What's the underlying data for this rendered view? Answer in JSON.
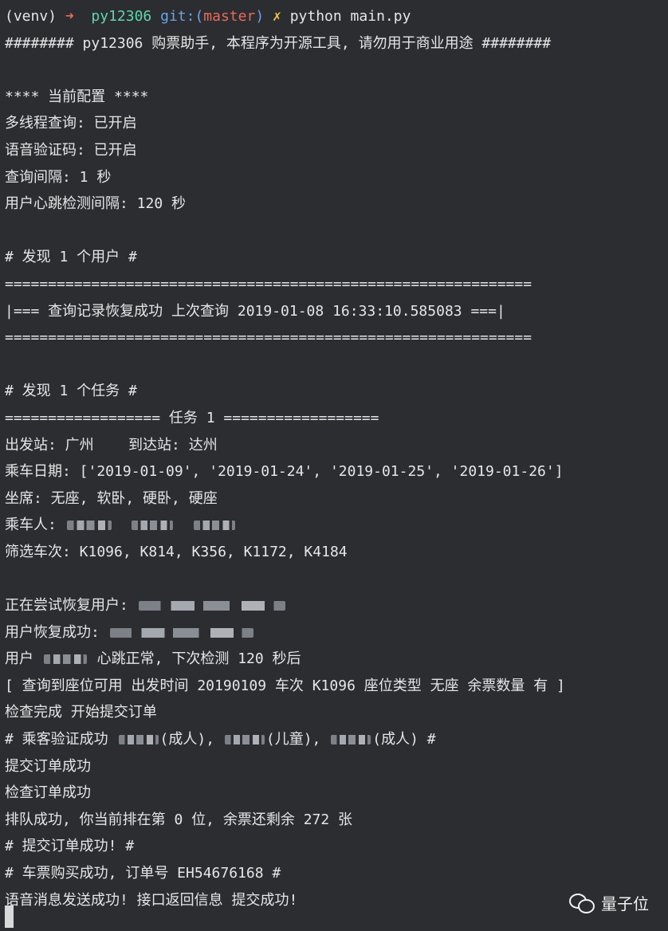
{
  "prompt": {
    "venv": "(venv)",
    "arrow": "➜",
    "dir": "py12306",
    "git_prefix": "git:(",
    "branch": "master",
    "git_suffix": ")",
    "dirty": "✗",
    "command": "python main.py"
  },
  "terminal": {
    "header": "######## py12306 购票助手, 本程序为开源工具, 请勿用于商业用途 ########",
    "config_title": "**** 当前配置 ****",
    "config_multithread": "多线程查询: 已开启",
    "config_voice": "语音验证码: 已开启",
    "config_interval": "查询间隔: 1 秒",
    "config_heartbeat": "用户心跳检测间隔: 120 秒",
    "found_users": "# 发现 1 个用户 #",
    "sep_long_1": "=============================================================",
    "restore_record": "|=== 查询记录恢复成功 上次查询 2019-01-08 16:33:10.585083 ===|",
    "sep_long_2": "=============================================================",
    "found_tasks": "# 发现 1 个任务 #",
    "task_header": "================== 任务 1 ==================",
    "stations": "出发站: 广州    到达站: 达州",
    "dates": "乘车日期: ['2019-01-09', '2019-01-24', '2019-01-25', '2019-01-26']",
    "seats": "坐席: 无座, 软卧, 硬卧, 硬座",
    "passengers_label": "乘车人: ",
    "filter_trains": "筛选车次: K1096, K814, K356, K1172, K4184",
    "restoring_user_label": "正在尝试恢复用户: ",
    "restore_ok_label": "用户恢复成功: ",
    "heartbeat_prefix": "用户 ",
    "heartbeat_suffix": " 心跳正常, 下次检测 120 秒后",
    "seat_available": "[ 查询到座位可用 出发时间 20190109 车次 K1096 座位类型 无座 余票数量 有 ]",
    "check_done": "检查完成 开始提交订单",
    "passenger_verify_prefix": "# 乘客验证成功 ",
    "passenger_adult1": "(成人), ",
    "passenger_child": "(儿童), ",
    "passenger_adult2": "(成人) #",
    "submit_ok": "提交订单成功",
    "check_order_ok": "检查订单成功",
    "queue_ok": "排队成功, 你当前排在第 0 位, 余票还剩余 272 张",
    "submit_order_ok": "# 提交订单成功! #",
    "ticket_ok": "# 车票购买成功, 订单号 EH54676168 #",
    "voice_ok": "语音消息发送成功! 接口返回信息 提交成功!"
  },
  "watermark": {
    "icon": "wechat-icon",
    "text": "量子位"
  }
}
